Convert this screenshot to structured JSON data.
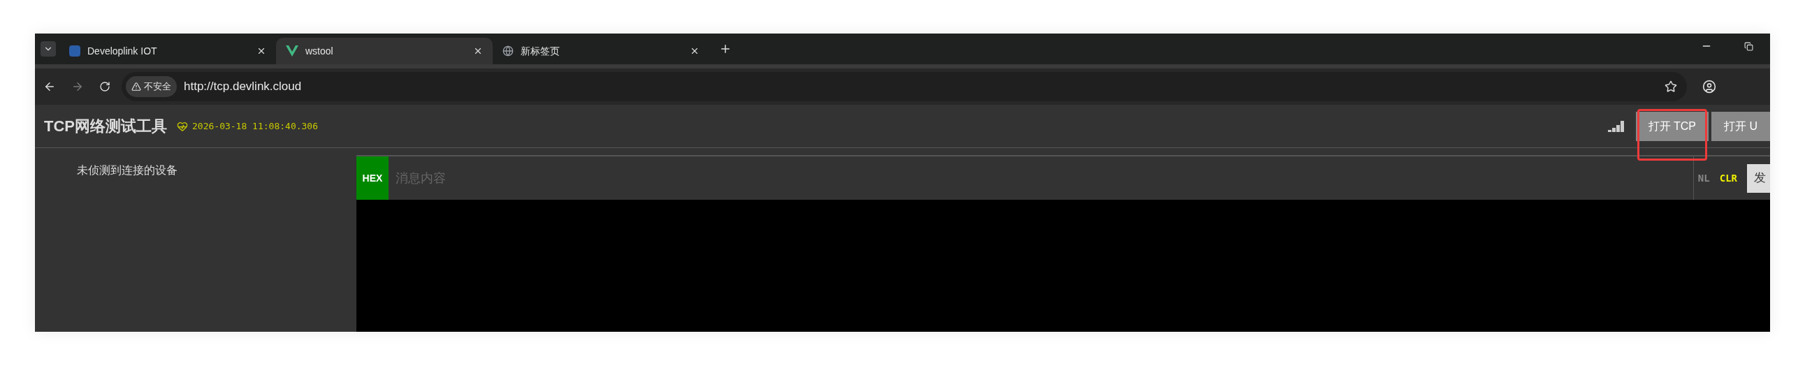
{
  "browser": {
    "tabs": [
      {
        "title": "Developlink IOT",
        "selected": false
      },
      {
        "title": "wstool",
        "selected": true
      },
      {
        "title": "新标签页",
        "selected": false
      }
    ],
    "security_label": "不安全",
    "url": "http://tcp.devlink.cloud"
  },
  "app": {
    "title": "TCP网络测试工具",
    "timestamp": "2026-03-18 11:08:40.306",
    "buttons": [
      {
        "label": "打开 TCP",
        "highlighted": true
      },
      {
        "label": "打开 U",
        "highlighted": false
      }
    ]
  },
  "sidebar": {
    "message": "未侦测到连接的设备"
  },
  "composer": {
    "hex": {
      "label": "HEX",
      "on": true
    },
    "placeholder": "消息内容",
    "toggles": [
      {
        "label": "NL",
        "on": false
      },
      {
        "label": "CLR",
        "on": true
      }
    ],
    "send": "发"
  }
}
